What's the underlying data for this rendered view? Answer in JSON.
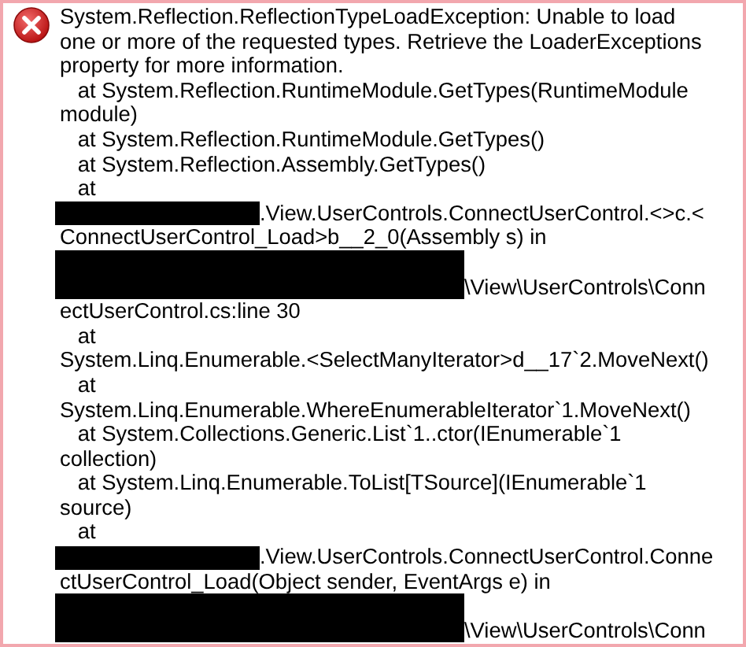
{
  "icon": {
    "kind": "error"
  },
  "lines": [
    {
      "kind": "plain",
      "text": "System.Reflection.ReflectionTypeLoadException: Unable to load"
    },
    {
      "kind": "plain",
      "text": "one or more of the requested types. Retrieve the LoaderExceptions"
    },
    {
      "kind": "plain",
      "text": "property for more information."
    },
    {
      "kind": "plain",
      "text": "   at System.Reflection.RuntimeModule.GetTypes(RuntimeModule"
    },
    {
      "kind": "plain",
      "text": "module)"
    },
    {
      "kind": "plain",
      "text": "   at System.Reflection.RuntimeModule.GetTypes()"
    },
    {
      "kind": "plain",
      "text": "   at System.Reflection.Assembly.GetTypes()"
    },
    {
      "kind": "plain",
      "text": "   at"
    },
    {
      "kind": "redacted",
      "text": ".View.UserControls.ConnectUserControl.<>c.<"
    },
    {
      "kind": "plain",
      "text": "ConnectUserControl_Load>b__2_0(Assembly s) in"
    },
    {
      "kind": "redacted_path",
      "text": "\\View\\UserControls\\Conn"
    },
    {
      "kind": "plain",
      "text": "ectUserControl.cs:line 30"
    },
    {
      "kind": "plain",
      "text": "   at"
    },
    {
      "kind": "plain",
      "text": "System.Linq.Enumerable.<SelectManyIterator>d__17`2.MoveNext()"
    },
    {
      "kind": "plain",
      "text": "   at"
    },
    {
      "kind": "plain",
      "text": "System.Linq.Enumerable.WhereEnumerableIterator`1.MoveNext()"
    },
    {
      "kind": "plain",
      "text": "   at System.Collections.Generic.List`1..ctor(IEnumerable`1"
    },
    {
      "kind": "plain",
      "text": "collection)"
    },
    {
      "kind": "plain",
      "text": "   at System.Linq.Enumerable.ToList[TSource](IEnumerable`1"
    },
    {
      "kind": "plain",
      "text": "source)"
    },
    {
      "kind": "plain",
      "text": "   at"
    },
    {
      "kind": "redacted",
      "text": ".View.UserControls.ConnectUserControl.Conne"
    },
    {
      "kind": "plain",
      "text": "ctUserControl_Load(Object sender, EventArgs e) in"
    },
    {
      "kind": "redacted_path",
      "text": "\\View\\UserControls\\Conn"
    }
  ]
}
